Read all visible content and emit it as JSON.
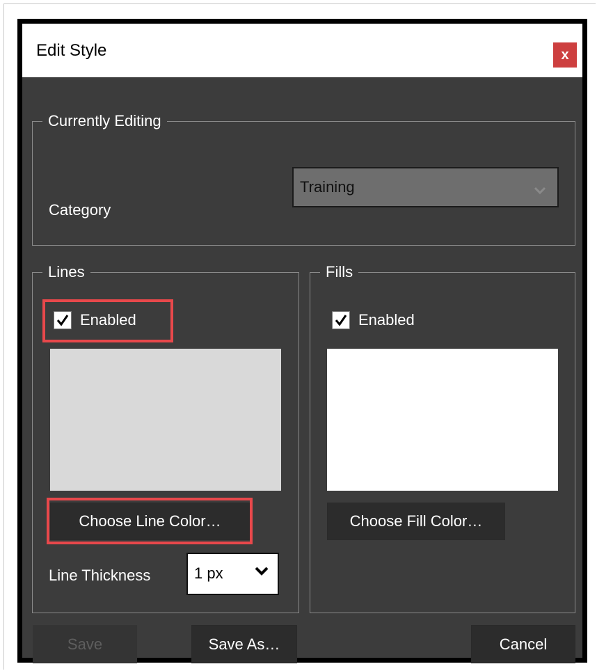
{
  "dialog": {
    "title": "Edit Style",
    "close_label": "x"
  },
  "currently_editing": {
    "legend": "Currently Editing",
    "category_label": "Category",
    "category_value": "Training"
  },
  "lines": {
    "legend": "Lines",
    "enabled_label": "Enabled",
    "enabled_checked": true,
    "swatch_color": "#d9d9d9",
    "choose_color_label": "Choose Line Color…",
    "thickness_label": "Line Thickness",
    "thickness_value": "1 px"
  },
  "fills": {
    "legend": "Fills",
    "enabled_label": "Enabled",
    "enabled_checked": true,
    "swatch_color": "#ffffff",
    "choose_color_label": "Choose Fill Color…"
  },
  "footer": {
    "save_label": "Save",
    "save_as_label": "Save As…",
    "cancel_label": "Cancel"
  },
  "colors": {
    "highlight": "#e8484b",
    "dialog_bg": "#3c3c3c",
    "close_button": "#cd3f3f"
  }
}
